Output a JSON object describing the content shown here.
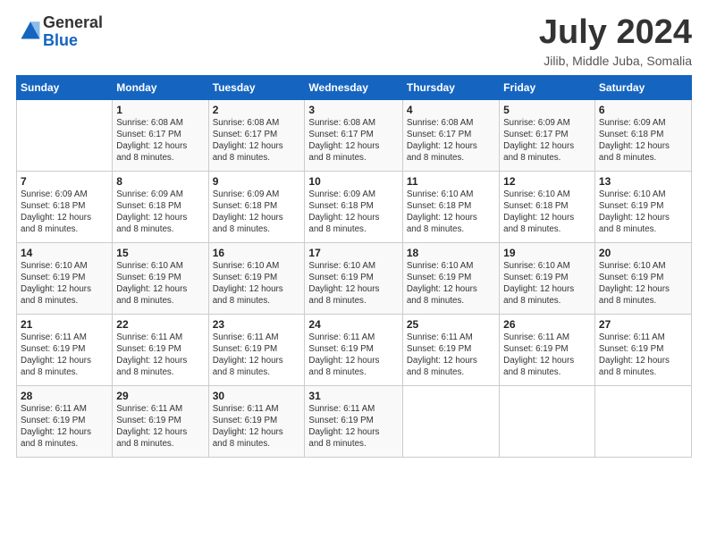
{
  "logo": {
    "general": "General",
    "blue": "Blue"
  },
  "title": "July 2024",
  "location": "Jilib, Middle Juba, Somalia",
  "days_of_week": [
    "Sunday",
    "Monday",
    "Tuesday",
    "Wednesday",
    "Thursday",
    "Friday",
    "Saturday"
  ],
  "weeks": [
    [
      {
        "day": "",
        "info": ""
      },
      {
        "day": "1",
        "info": "Sunrise: 6:08 AM\nSunset: 6:17 PM\nDaylight: 12 hours\nand 8 minutes."
      },
      {
        "day": "2",
        "info": "Sunrise: 6:08 AM\nSunset: 6:17 PM\nDaylight: 12 hours\nand 8 minutes."
      },
      {
        "day": "3",
        "info": "Sunrise: 6:08 AM\nSunset: 6:17 PM\nDaylight: 12 hours\nand 8 minutes."
      },
      {
        "day": "4",
        "info": "Sunrise: 6:08 AM\nSunset: 6:17 PM\nDaylight: 12 hours\nand 8 minutes."
      },
      {
        "day": "5",
        "info": "Sunrise: 6:09 AM\nSunset: 6:17 PM\nDaylight: 12 hours\nand 8 minutes."
      },
      {
        "day": "6",
        "info": "Sunrise: 6:09 AM\nSunset: 6:18 PM\nDaylight: 12 hours\nand 8 minutes."
      }
    ],
    [
      {
        "day": "7",
        "info": "Sunrise: 6:09 AM\nSunset: 6:18 PM\nDaylight: 12 hours\nand 8 minutes."
      },
      {
        "day": "8",
        "info": "Sunrise: 6:09 AM\nSunset: 6:18 PM\nDaylight: 12 hours\nand 8 minutes."
      },
      {
        "day": "9",
        "info": "Sunrise: 6:09 AM\nSunset: 6:18 PM\nDaylight: 12 hours\nand 8 minutes."
      },
      {
        "day": "10",
        "info": "Sunrise: 6:09 AM\nSunset: 6:18 PM\nDaylight: 12 hours\nand 8 minutes."
      },
      {
        "day": "11",
        "info": "Sunrise: 6:10 AM\nSunset: 6:18 PM\nDaylight: 12 hours\nand 8 minutes."
      },
      {
        "day": "12",
        "info": "Sunrise: 6:10 AM\nSunset: 6:18 PM\nDaylight: 12 hours\nand 8 minutes."
      },
      {
        "day": "13",
        "info": "Sunrise: 6:10 AM\nSunset: 6:19 PM\nDaylight: 12 hours\nand 8 minutes."
      }
    ],
    [
      {
        "day": "14",
        "info": "Sunrise: 6:10 AM\nSunset: 6:19 PM\nDaylight: 12 hours\nand 8 minutes."
      },
      {
        "day": "15",
        "info": "Sunrise: 6:10 AM\nSunset: 6:19 PM\nDaylight: 12 hours\nand 8 minutes."
      },
      {
        "day": "16",
        "info": "Sunrise: 6:10 AM\nSunset: 6:19 PM\nDaylight: 12 hours\nand 8 minutes."
      },
      {
        "day": "17",
        "info": "Sunrise: 6:10 AM\nSunset: 6:19 PM\nDaylight: 12 hours\nand 8 minutes."
      },
      {
        "day": "18",
        "info": "Sunrise: 6:10 AM\nSunset: 6:19 PM\nDaylight: 12 hours\nand 8 minutes."
      },
      {
        "day": "19",
        "info": "Sunrise: 6:10 AM\nSunset: 6:19 PM\nDaylight: 12 hours\nand 8 minutes."
      },
      {
        "day": "20",
        "info": "Sunrise: 6:10 AM\nSunset: 6:19 PM\nDaylight: 12 hours\nand 8 minutes."
      }
    ],
    [
      {
        "day": "21",
        "info": "Sunrise: 6:11 AM\nSunset: 6:19 PM\nDaylight: 12 hours\nand 8 minutes."
      },
      {
        "day": "22",
        "info": "Sunrise: 6:11 AM\nSunset: 6:19 PM\nDaylight: 12 hours\nand 8 minutes."
      },
      {
        "day": "23",
        "info": "Sunrise: 6:11 AM\nSunset: 6:19 PM\nDaylight: 12 hours\nand 8 minutes."
      },
      {
        "day": "24",
        "info": "Sunrise: 6:11 AM\nSunset: 6:19 PM\nDaylight: 12 hours\nand 8 minutes."
      },
      {
        "day": "25",
        "info": "Sunrise: 6:11 AM\nSunset: 6:19 PM\nDaylight: 12 hours\nand 8 minutes."
      },
      {
        "day": "26",
        "info": "Sunrise: 6:11 AM\nSunset: 6:19 PM\nDaylight: 12 hours\nand 8 minutes."
      },
      {
        "day": "27",
        "info": "Sunrise: 6:11 AM\nSunset: 6:19 PM\nDaylight: 12 hours\nand 8 minutes."
      }
    ],
    [
      {
        "day": "28",
        "info": "Sunrise: 6:11 AM\nSunset: 6:19 PM\nDaylight: 12 hours\nand 8 minutes."
      },
      {
        "day": "29",
        "info": "Sunrise: 6:11 AM\nSunset: 6:19 PM\nDaylight: 12 hours\nand 8 minutes."
      },
      {
        "day": "30",
        "info": "Sunrise: 6:11 AM\nSunset: 6:19 PM\nDaylight: 12 hours\nand 8 minutes."
      },
      {
        "day": "31",
        "info": "Sunrise: 6:11 AM\nSunset: 6:19 PM\nDaylight: 12 hours\nand 8 minutes."
      },
      {
        "day": "",
        "info": ""
      },
      {
        "day": "",
        "info": ""
      },
      {
        "day": "",
        "info": ""
      }
    ]
  ]
}
